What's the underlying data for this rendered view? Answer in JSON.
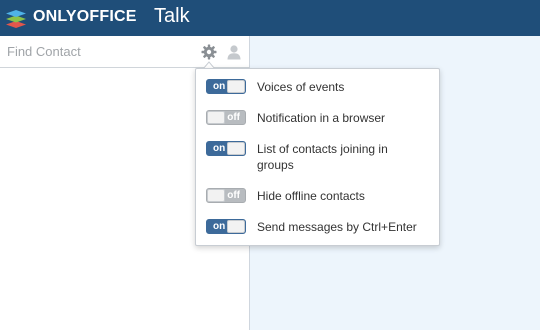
{
  "header": {
    "brand": "ONLYOFFICE",
    "module": "Talk",
    "logo_icon": "onlyoffice-logo-icon",
    "background": "#1f4e79"
  },
  "sidebar": {
    "search": {
      "placeholder": "Find Contact",
      "value": ""
    },
    "settings_icon": "gear-icon",
    "contact_icon": "person-icon"
  },
  "settings_menu": {
    "items": [
      {
        "label": "Voices of events",
        "state": "on",
        "enabled": true
      },
      {
        "label": "Notification in a browser",
        "state": "off",
        "enabled": false
      },
      {
        "label": "List of contacts joining in groups",
        "state": "on",
        "enabled": true
      },
      {
        "label": "Hide offline contacts",
        "state": "off",
        "enabled": false
      },
      {
        "label": "Send messages by Ctrl+Enter",
        "state": "on",
        "enabled": true
      }
    ]
  },
  "colors": {
    "toggle_on": "#3d6a9a",
    "toggle_off": "#b8bcc0",
    "chat_background": "#edf5fc"
  }
}
